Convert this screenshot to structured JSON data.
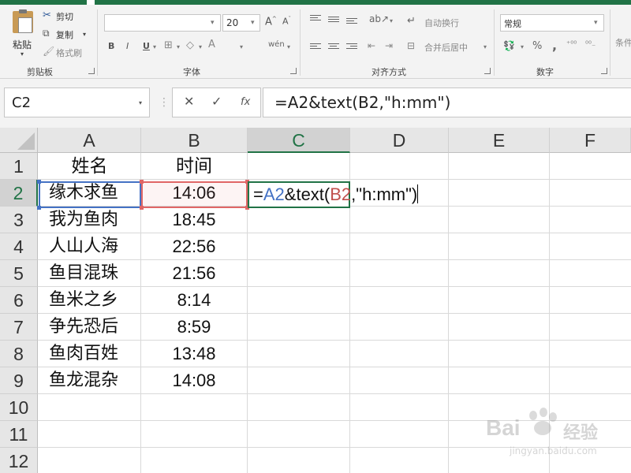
{
  "ribbon": {
    "clipboard": {
      "paste_label": "粘贴",
      "cut_label": "剪切",
      "copy_label": "复制",
      "format_painter_label": "格式刷",
      "group_label": "剪贴板"
    },
    "font": {
      "font_name": "",
      "font_size": "20",
      "group_label": "字体",
      "bold": "B",
      "italic": "I",
      "underline": "U"
    },
    "alignment": {
      "wrap_text_label": "自动换行",
      "merge_center_label": "合并后居中",
      "group_label": "对齐方式"
    },
    "number": {
      "format_value": "常规",
      "percent": "%",
      "comma": ",",
      "group_label": "数字"
    },
    "styles": {
      "partial_label": "条件"
    }
  },
  "formula_bar": {
    "name_box": "C2",
    "formula": "=A2&text(B2,\"h:mm\")"
  },
  "sheet": {
    "columns": [
      "A",
      "B",
      "C",
      "D",
      "E",
      "F"
    ],
    "rows": [
      "1",
      "2",
      "3",
      "4",
      "5",
      "6",
      "7",
      "8",
      "9",
      "10",
      "11",
      "12"
    ],
    "header": {
      "name": "姓名",
      "time": "时间"
    },
    "data": [
      {
        "name": "缘木求鱼",
        "time": "14:06"
      },
      {
        "name": "我为鱼肉",
        "time": "18:45"
      },
      {
        "name": "人山人海",
        "time": "22:56"
      },
      {
        "name": "鱼目混珠",
        "time": "21:56"
      },
      {
        "name": "鱼米之乡",
        "time": "8:14"
      },
      {
        "name": "争先恐后",
        "time": "8:59"
      },
      {
        "name": "鱼肉百姓",
        "time": "13:48"
      },
      {
        "name": "鱼龙混杂",
        "time": "14:08"
      }
    ],
    "edit_cell": {
      "prefix": "=",
      "ref1": "A2",
      "middle": "&text(",
      "ref2": "B2",
      "suffix": ",\"h:mm\")"
    }
  },
  "watermark": {
    "brand": "Bai",
    "brand2": "经验",
    "url": "jingyan.baidu.com"
  }
}
